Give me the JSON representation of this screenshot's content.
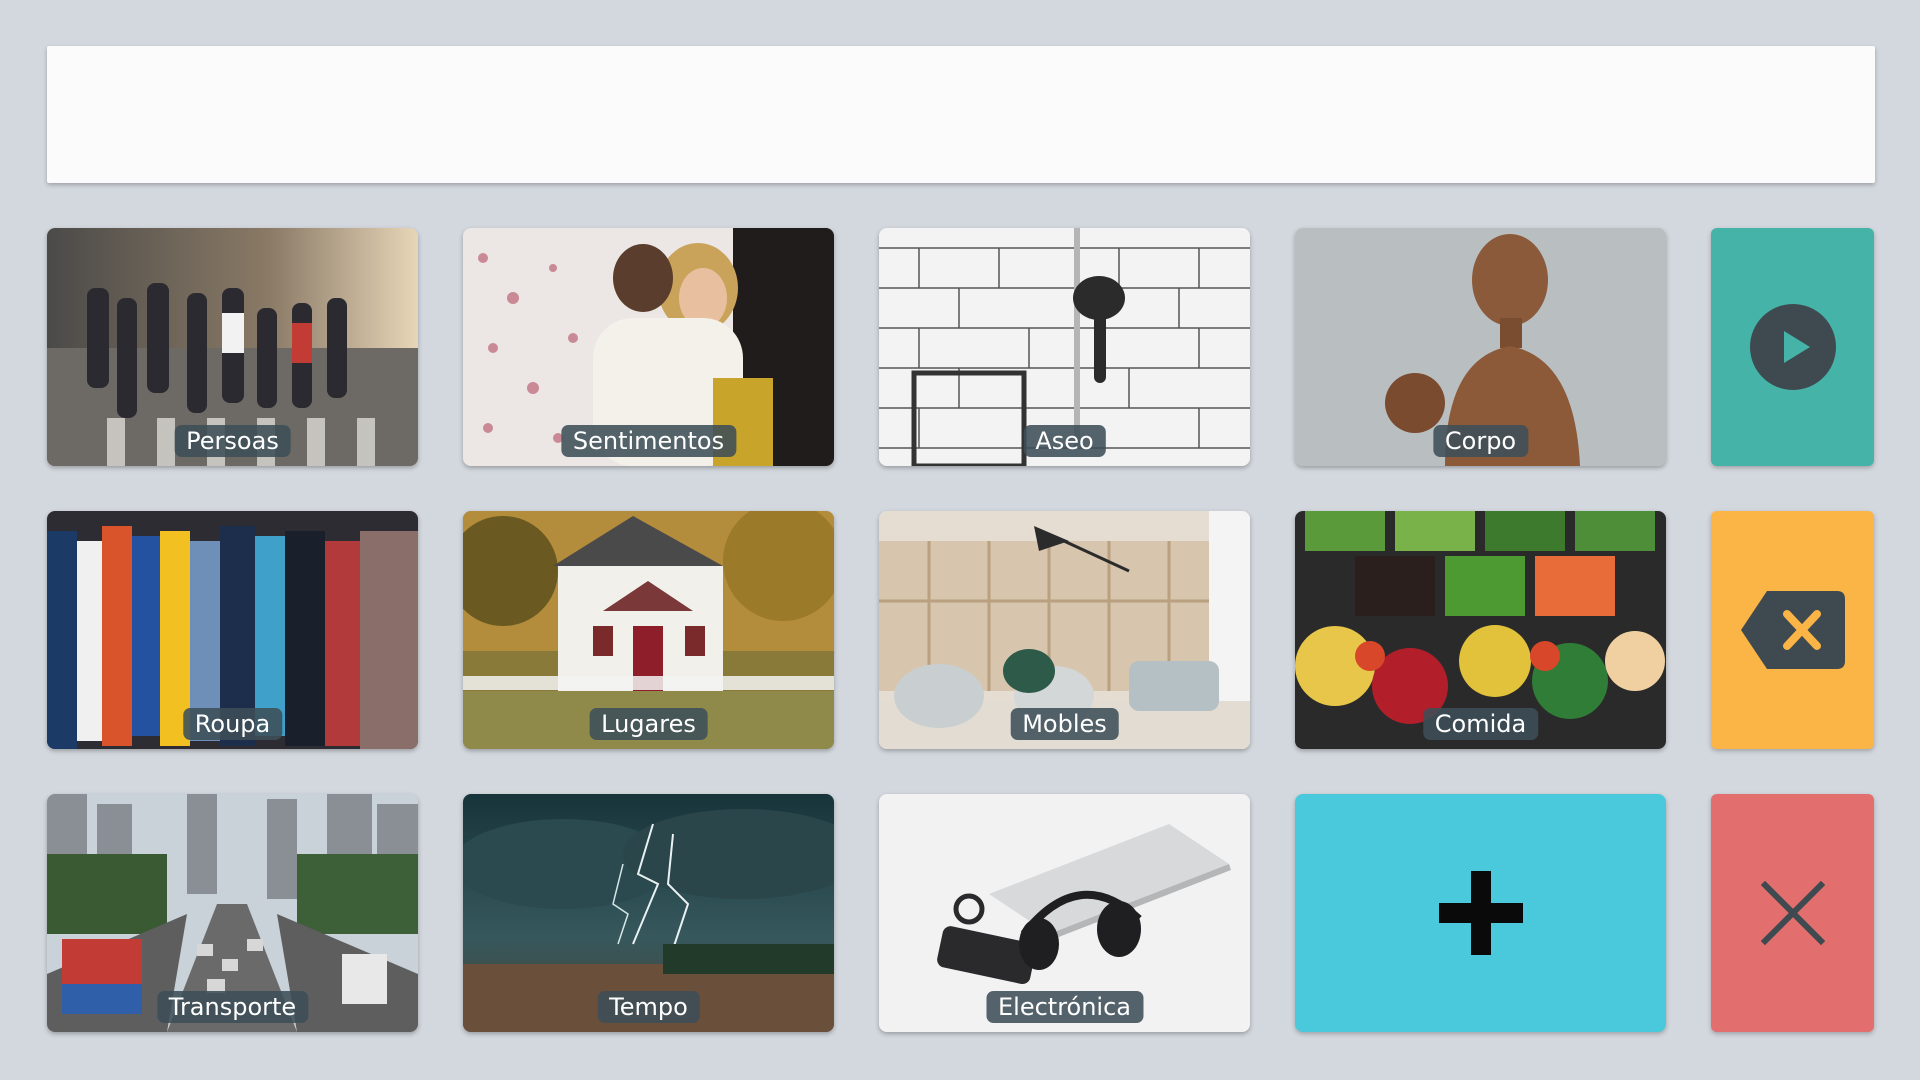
{
  "output_bar": {
    "text": ""
  },
  "categories": [
    {
      "label": "Persoas",
      "icon": "people-crossing-street-image"
    },
    {
      "label": "Sentimentos",
      "icon": "people-hugging-image"
    },
    {
      "label": "Aseo",
      "icon": "shower-head-image"
    },
    {
      "label": "Corpo",
      "icon": "wooden-mannequin-image"
    },
    {
      "label": "Roupa",
      "icon": "clothes-rack-image"
    },
    {
      "label": "Lugares",
      "icon": "house-image"
    },
    {
      "label": "Mobles",
      "icon": "furniture-room-image"
    },
    {
      "label": "Comida",
      "icon": "vegetables-image"
    },
    {
      "label": "Transporte",
      "icon": "city-traffic-image"
    },
    {
      "label": "Tempo",
      "icon": "storm-lightning-image"
    },
    {
      "label": "Electrónica",
      "icon": "headphones-devices-image"
    }
  ],
  "actions": {
    "add": {
      "icon": "plus-icon",
      "color": "#4ac8dc"
    },
    "play": {
      "icon": "play-icon",
      "color": "#45b3a8"
    },
    "backspace": {
      "icon": "backspace-icon",
      "color": "#fbb547"
    },
    "clear": {
      "icon": "close-icon",
      "color": "#e36e6e"
    }
  },
  "colors": {
    "background": "#d3d8de",
    "label_background": "#3e4e58",
    "icon_dark": "#3f4a50"
  }
}
